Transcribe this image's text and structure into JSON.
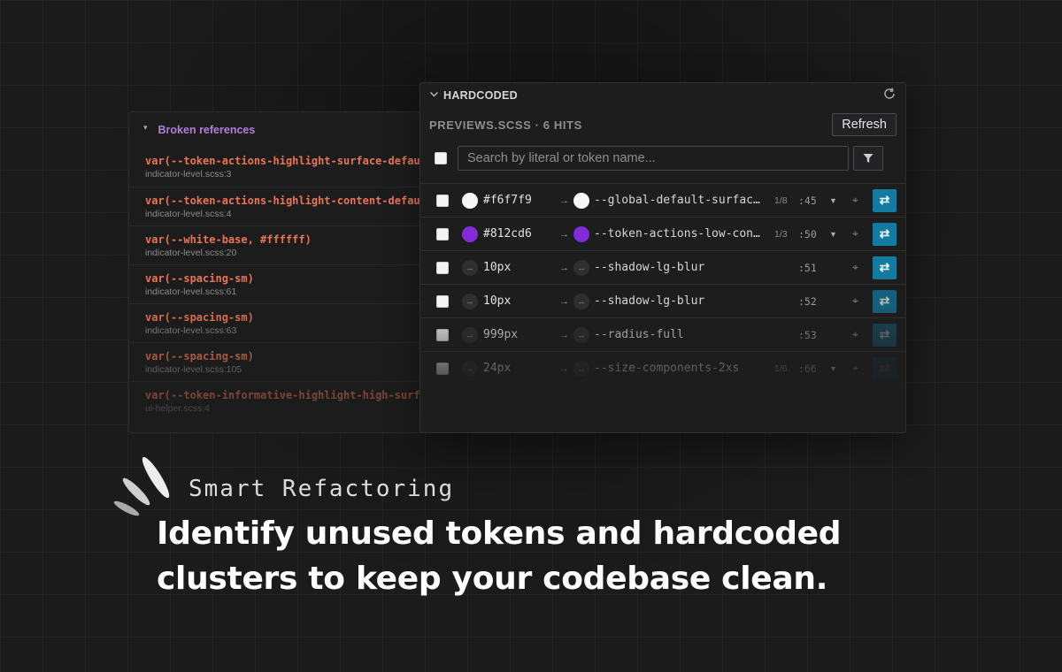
{
  "broken_refs": {
    "title": "Broken references",
    "items": [
      {
        "code": "var(--token-actions-highlight-surface-default, #f",
        "file": "indicator-level.scss:3"
      },
      {
        "code": "var(--token-actions-highlight-content-default, #f",
        "file": "indicator-level.scss:4"
      },
      {
        "code": "var(--white-base, #ffffff)",
        "file": "indicator-level.scss:20"
      },
      {
        "code": "var(--spacing-sm)",
        "file": "indicator-level.scss:61"
      },
      {
        "code": "var(--spacing-sm)",
        "file": "indicator-level.scss:63"
      },
      {
        "code": "var(--spacing-sm)",
        "file": "indicator-level.scss:105"
      },
      {
        "code": "var(--token-informative-highlight-high-surface-d",
        "file": "ui-helper.scss:4"
      }
    ]
  },
  "hardcoded": {
    "title": "HARDCODED",
    "file_summary": "PREVIEWS.SCSS · 6 HITS",
    "refresh_label": "Refresh",
    "search_placeholder": "Search by literal or token name...",
    "rows": [
      {
        "kind": "color",
        "color": "#f6f7f9",
        "literal": "#f6f7f9",
        "token": "--global-default-surfac…",
        "count": "1/8",
        "line": ":45",
        "dropdown": true
      },
      {
        "kind": "color",
        "color": "#812cd6",
        "literal": "#812cd6",
        "token": "--token-actions-low-con…",
        "count": "1/3",
        "line": ":50",
        "dropdown": true
      },
      {
        "kind": "size",
        "literal": "10px",
        "token": "--shadow-lg-blur",
        "count": "",
        "line": ":51",
        "dropdown": false
      },
      {
        "kind": "size",
        "literal": "10px",
        "token": "--shadow-lg-blur",
        "count": "",
        "line": ":52",
        "dropdown": false
      },
      {
        "kind": "size",
        "literal": "999px",
        "token": "--radius-full",
        "count": "",
        "line": ":53",
        "dropdown": false
      },
      {
        "kind": "size",
        "literal": "24px",
        "token": "--size-components-2xs",
        "count": "1/6",
        "line": ":66",
        "dropdown": true
      }
    ]
  },
  "caption": {
    "kicker": "Smart Refactoring",
    "headline_line1": "Identify unused tokens and hardcoded",
    "headline_line2": "clusters to keep your codebase clean."
  },
  "colors": {
    "accent_purple": "#b07fd8",
    "error_orange": "#e87555",
    "apply_blue": "#147aa0"
  },
  "icons": {
    "collapse": "caret-down-icon",
    "refresh": "refresh-icon",
    "filter": "filter-icon",
    "arrow": "arrow-right-icon",
    "size": "resize-icon",
    "target": "crosshair-icon",
    "apply": "swap-icon"
  }
}
